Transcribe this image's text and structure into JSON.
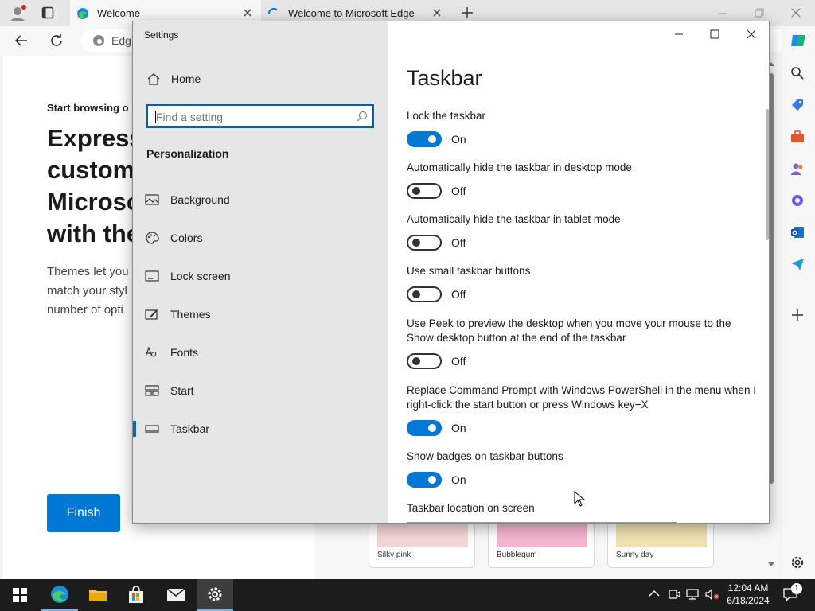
{
  "browser": {
    "tabs": [
      {
        "title": "Welcome"
      },
      {
        "title": "Welcome to Microsoft Edge"
      }
    ],
    "address_partial": "Edg",
    "page": {
      "kicker": "Start browsing o",
      "headline_lines": [
        "Express",
        "custom",
        "Microso",
        "with the"
      ],
      "body_lines": [
        "Themes let you",
        "match your styl",
        "number of opti"
      ],
      "finish_label": "Finish"
    },
    "themes": [
      {
        "name": "Silky pink",
        "color": "#f3d6d6"
      },
      {
        "name": "Bubblegum",
        "color": "#f4b6d0"
      },
      {
        "name": "Sunny day",
        "color": "#efe1b0"
      }
    ]
  },
  "settings": {
    "window_title": "Settings",
    "home_label": "Home",
    "search_placeholder": "Find a setting",
    "section": "Personalization",
    "nav_items": [
      {
        "label": "Background",
        "icon": "image-icon"
      },
      {
        "label": "Colors",
        "icon": "palette-icon"
      },
      {
        "label": "Lock screen",
        "icon": "lock-screen-icon"
      },
      {
        "label": "Themes",
        "icon": "themes-brush-icon"
      },
      {
        "label": "Fonts",
        "icon": "fonts-icon"
      },
      {
        "label": "Start",
        "icon": "start-icon"
      },
      {
        "label": "Taskbar",
        "icon": "taskbar-icon",
        "selected": true
      }
    ],
    "page_title": "Taskbar",
    "options": [
      {
        "label": "Lock the taskbar",
        "state": "On",
        "on": true
      },
      {
        "label": "Automatically hide the taskbar in desktop mode",
        "state": "Off",
        "on": false
      },
      {
        "label": "Automatically hide the taskbar in tablet mode",
        "state": "Off",
        "on": false
      },
      {
        "label": "Use small taskbar buttons",
        "state": "Off",
        "on": false
      },
      {
        "label": "Use Peek to preview the desktop when you move your mouse to the Show desktop button at the end of the taskbar",
        "state": "Off",
        "on": false
      },
      {
        "label": "Replace Command Prompt with Windows PowerShell in the menu when I right-click the start button or press Windows key+X",
        "state": "On",
        "on": true
      },
      {
        "label": "Show badges on taskbar buttons",
        "state": "On",
        "on": true
      }
    ],
    "location_label": "Taskbar location on screen"
  },
  "taskbar": {
    "time": "12:04 AM",
    "date": "6/18/2024",
    "notification_count": "1"
  },
  "colors": {
    "accent": "#0078d4",
    "finish_button": "#0078d4",
    "taskbar": "#1c1c1c"
  }
}
